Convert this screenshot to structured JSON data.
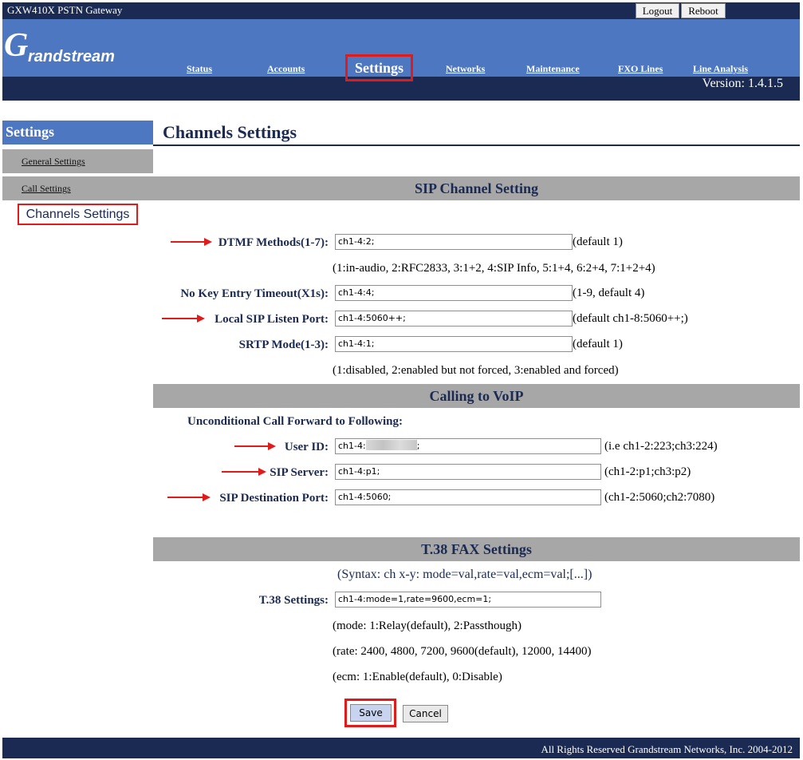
{
  "topbar": {
    "product_name": "GXW410X PSTN Gateway",
    "logout_label": "Logout",
    "reboot_label": "Reboot"
  },
  "header": {
    "logo_main": "G",
    "logo_rest": "randstream",
    "version": "Version: 1.4.1.5",
    "nav": {
      "status": "Status",
      "accounts": "Accounts",
      "settings": "Settings",
      "networks": "Networks",
      "maintenance": "Maintenance",
      "fxo_lines": "FXO Lines",
      "line_analysis": "Line Analysis"
    }
  },
  "sidebar": {
    "title": "Settings",
    "items": [
      {
        "label": "General Settings"
      },
      {
        "label": "Call Settings"
      },
      {
        "label": "Channels Settings"
      }
    ]
  },
  "main": {
    "page_title": "Channels Settings",
    "sip_channel": {
      "heading": "SIP Channel Setting",
      "dtmf_label": "DTMF Methods(1-7):",
      "dtmf_value": "ch1-4:2;",
      "dtmf_note": "(default 1)",
      "dtmf_help": "(1:in-audio, 2:RFC2833, 3:1+2, 4:SIP Info, 5:1+4, 6:2+4, 7:1+2+4)",
      "nokey_label": "No Key Entry Timeout(X1s):",
      "nokey_value": "ch1-4:4;",
      "nokey_note": "(1-9, default 4)",
      "listen_label": "Local SIP Listen Port:",
      "listen_value": "ch1-4:5060++;",
      "listen_note": "(default ch1-8:5060++;)",
      "srtp_label": "SRTP Mode(1-3):",
      "srtp_value": "ch1-4:1;",
      "srtp_note": "(default 1)",
      "srtp_help": "(1:disabled, 2:enabled but not forced, 3:enabled and forced)"
    },
    "calling_voip": {
      "heading": "Calling to VoIP",
      "subheading": "Unconditional Call Forward to Following:",
      "userid_label": "User ID:",
      "userid_prefix": "ch1-4:",
      "userid_suffix": ";",
      "userid_note": "(i.e ch1-2:223;ch3:224)",
      "server_label": "SIP Server:",
      "server_value": "ch1-4:p1;",
      "server_note": "(ch1-2:p1;ch3:p2)",
      "dport_label": "SIP Destination Port:",
      "dport_value": "ch1-4:5060;",
      "dport_note": "(ch1-2:5060;ch2:7080)"
    },
    "t38": {
      "heading": "T.38 FAX Settings",
      "syntax": "(Syntax: ch x-y: mode=val,rate=val,ecm=val;[...])",
      "label": "T.38 Settings:",
      "value": "ch1-4:mode=1,rate=9600,ecm=1;",
      "mode_help": "(mode: 1:Relay(default), 2:Passthough)",
      "rate_help": "(rate: 2400, 4800, 7200, 9600(default), 12000, 14400)",
      "ecm_help": "(ecm: 1:Enable(default), 0:Disable)"
    },
    "save_label": "Save",
    "cancel_label": "Cancel"
  },
  "footer": {
    "copyright": "All Rights Reserved Grandstream Networks, Inc. 2004-2012"
  },
  "colors": {
    "navy": "#1b2a52",
    "brand_blue": "#4d78c1",
    "section_gray": "#a7a7a7",
    "highlight_red": "#e01b1b"
  }
}
